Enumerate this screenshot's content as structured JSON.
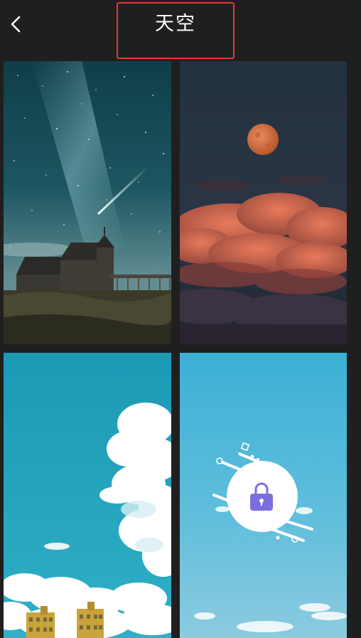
{
  "header": {
    "title": "天空",
    "back_icon": "chevron-left-icon"
  },
  "colors": {
    "background": "#1f1f1f",
    "title_text": "#ffffff",
    "highlight_border": "#e53935",
    "lock_accent": "#7b6fe0"
  },
  "wallpapers": [
    {
      "scene": "starry-night-church",
      "locked": false
    },
    {
      "scene": "full-moon-red-clouds",
      "locked": false
    },
    {
      "scene": "blue-sky-cumulus-buildings",
      "locked": false
    },
    {
      "scene": "pale-blue-sky",
      "locked": true,
      "lock_icon": "padlock-icon"
    }
  ]
}
